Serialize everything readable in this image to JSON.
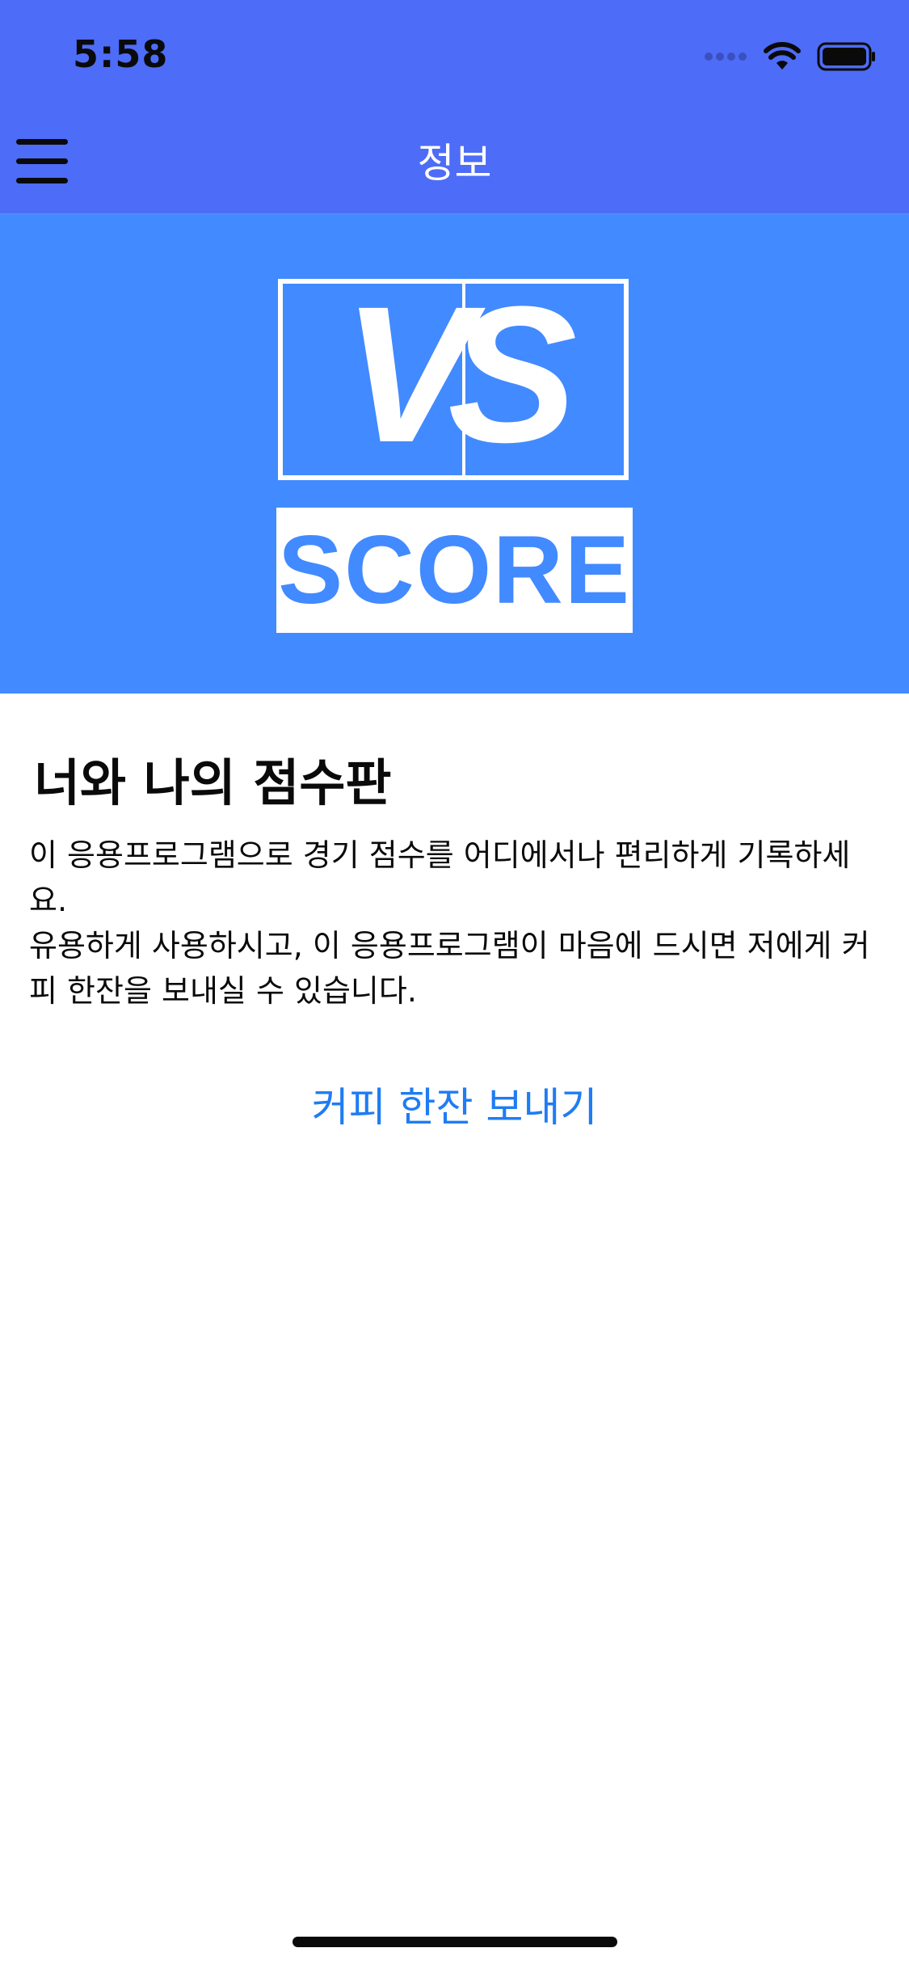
{
  "status_bar": {
    "time": "5:58",
    "icons": [
      "signal-dots-icon",
      "wifi-icon",
      "battery-icon"
    ]
  },
  "nav": {
    "title": "정보",
    "menu_icon": "hamburger-menu-icon"
  },
  "hero": {
    "logo_vs": "VS",
    "logo_score": "SCORE",
    "background_color": "#428aff"
  },
  "content": {
    "title": "너와 나의 점수판",
    "paragraphs": [
      "이 응용프로그램으로 경기 점수를 어디에서나 편리하게 기록하세요.",
      "유용하게 사용하시고, 이 응용프로그램이 마음에 드시면 저에게 커피 한잔을 보내실 수 있습니다."
    ],
    "coffee_button_label": "커피 한잔 보내기"
  },
  "colors": {
    "nav_background": "#4d6cf7",
    "link": "#1f7cf4"
  }
}
